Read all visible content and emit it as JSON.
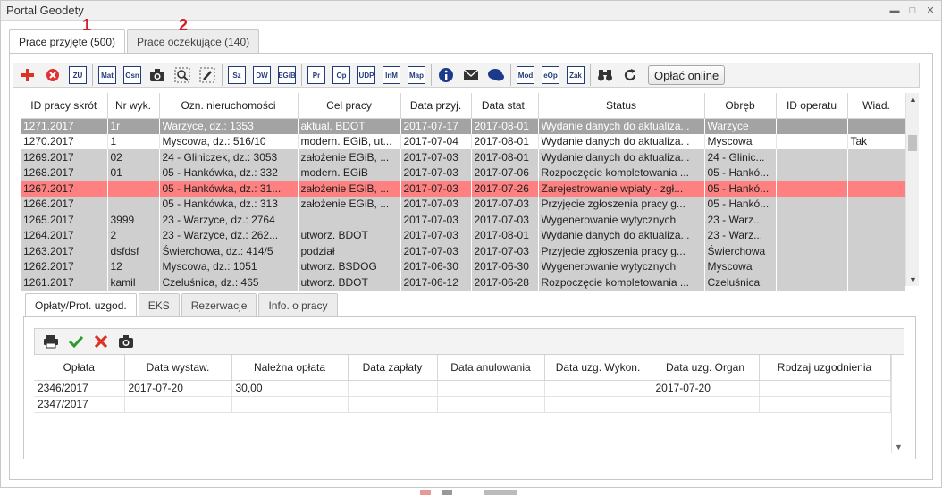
{
  "window": {
    "title": "Portal Geodety"
  },
  "outer_tabs": [
    {
      "label": "Prace przyjęte (500)",
      "marker": "1",
      "active": true
    },
    {
      "label": "Prace oczekujące (140)",
      "marker": "2",
      "active": false
    }
  ],
  "toolbar": {
    "text_buttons": [
      "ZU",
      "Mat",
      "Osn",
      "Sz",
      "DW",
      "EGiB",
      "Pr",
      "Op",
      "UDP",
      "InM",
      "Map",
      "Mod",
      "eOp",
      "Zak"
    ],
    "pay_button": "Opłać online",
    "icons": [
      "plus-icon",
      "cancel-circle-icon",
      "camera-icon",
      "search-dotted-icon",
      "edit-dotted-icon",
      "info-icon",
      "mail-icon",
      "chat-icon",
      "binoculars-icon",
      "refresh-icon"
    ]
  },
  "works_table": {
    "columns": [
      "ID pracy skrót",
      "Nr wyk.",
      "Ozn. nieruchomości",
      "Cel pracy",
      "Data przyj.",
      "Data stat.",
      "Status",
      "Obręb",
      "ID operatu",
      "Wiad."
    ],
    "rows": [
      {
        "style": "sel",
        "cells": [
          "1271.2017",
          "1r",
          "Warzyce, dz.: 1353",
          "aktual. BDOT",
          "2017-07-17",
          "2017-08-01",
          "Wydanie danych do aktualiza...",
          "Warzyce",
          "",
          ""
        ]
      },
      {
        "style": "white",
        "cells": [
          "1270.2017",
          "1",
          "Myscowa, dz.: 516/10",
          "modern. EGiB, ut...",
          "2017-07-04",
          "2017-08-01",
          "Wydanie danych do aktualiza...",
          "Myscowa",
          "",
          "Tak"
        ]
      },
      {
        "style": "gray",
        "cells": [
          "1269.2017",
          "02",
          "24 - Gliniczek, dz.: 3053",
          "założenie EGiB, ...",
          "2017-07-03",
          "2017-08-01",
          "Wydanie danych do aktualiza...",
          "24 - Glinic...",
          "",
          ""
        ]
      },
      {
        "style": "gray",
        "cells": [
          "1268.2017",
          "01",
          "05 - Hankówka, dz.: 332",
          "modern. EGiB",
          "2017-07-03",
          "2017-07-06",
          "Rozpoczęcie kompletowania ...",
          "05 - Hankó...",
          "",
          ""
        ]
      },
      {
        "style": "red",
        "cells": [
          "1267.2017",
          "",
          "05 - Hankówka, dz.: 31...",
          "założenie EGiB, ...",
          "2017-07-03",
          "2017-07-26",
          "Zarejestrowanie wpłaty - zgł...",
          "05 - Hankó...",
          "",
          ""
        ]
      },
      {
        "style": "gray",
        "cells": [
          "1266.2017",
          "",
          "05 - Hankówka, dz.: 313",
          "założenie EGiB, ...",
          "2017-07-03",
          "2017-07-03",
          "Przyjęcie zgłoszenia pracy g...",
          "05 - Hankó...",
          "",
          ""
        ]
      },
      {
        "style": "gray",
        "cells": [
          "1265.2017",
          "3999",
          "23 - Warzyce, dz.: 2764",
          "",
          "2017-07-03",
          "2017-07-03",
          "Wygenerowanie wytycznych",
          "23 - Warz...",
          "",
          ""
        ]
      },
      {
        "style": "gray",
        "cells": [
          "1264.2017",
          "2",
          "23 - Warzyce, dz.: 262...",
          "utworz. BDOT",
          "2017-07-03",
          "2017-08-01",
          "Wydanie danych do aktualiza...",
          "23 - Warz...",
          "",
          ""
        ]
      },
      {
        "style": "gray",
        "cells": [
          "1263.2017",
          "dsfdsf",
          "Świerchowa, dz.: 414/5",
          "podział",
          "2017-07-03",
          "2017-07-03",
          "Przyjęcie zgłoszenia pracy g...",
          "Świerchowa",
          "",
          ""
        ]
      },
      {
        "style": "gray",
        "cells": [
          "1262.2017",
          "12",
          "Myscowa, dz.: 1051",
          "utworz. BSDOG",
          "2017-06-30",
          "2017-06-30",
          "Wygenerowanie wytycznych",
          "Myscowa",
          "",
          ""
        ]
      },
      {
        "style": "gray",
        "cells": [
          "1261.2017",
          "kamil",
          "Czeluśnica, dz.: 465",
          "utworz. BDOT",
          "2017-06-12",
          "2017-06-28",
          "Rozpoczęcie kompletowania ...",
          "Czeluśnica",
          "",
          ""
        ]
      }
    ]
  },
  "inner_tabs": [
    {
      "label": "Opłaty/Prot. uzgod.",
      "active": true
    },
    {
      "label": "EKS",
      "active": false
    },
    {
      "label": "Rezerwacje",
      "active": false
    },
    {
      "label": "Info. o pracy",
      "active": false
    }
  ],
  "fees_table": {
    "columns": [
      "Opłata",
      "Data wystaw.",
      "Należna opłata",
      "Data zapłaty",
      "Data anulowania",
      "Data uzg. Wykon.",
      "Data uzg. Organ",
      "Rodzaj uzgodnienia"
    ],
    "rows": [
      [
        "2346/2017",
        "2017-07-20",
        "30,00",
        "",
        "",
        "",
        "2017-07-20",
        ""
      ],
      [
        "2347/2017",
        "",
        "",
        "",
        "",
        "",
        "",
        ""
      ]
    ]
  },
  "colors": {
    "selected_row": "#a3a3a3",
    "highlight_row": "#ff8080",
    "gray_row": "#cfcfcf",
    "marker": "#d0202a"
  }
}
